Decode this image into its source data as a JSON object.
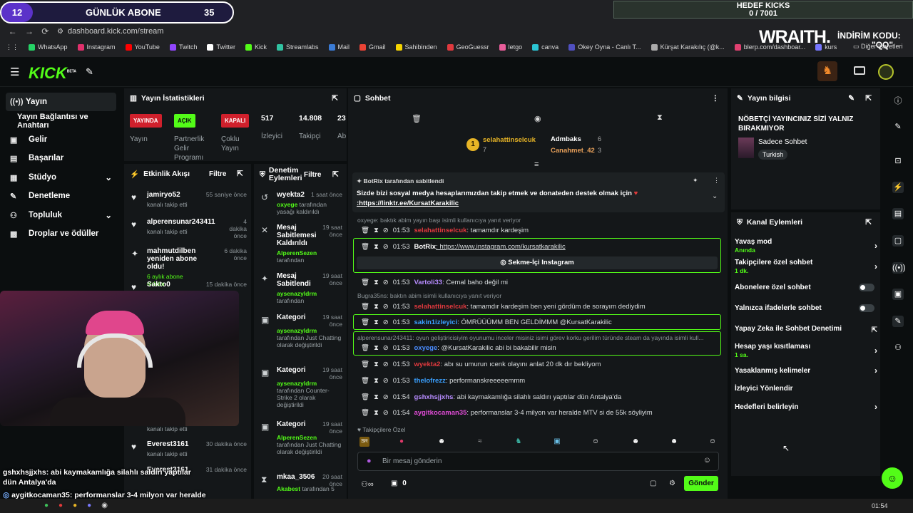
{
  "overlay": {
    "sub_count": "12",
    "sub_label": "GÜNLÜK ABONE",
    "sub_goal": "35",
    "kicks_title": "HEDEF KICKS",
    "kicks_value": "0 / 7001",
    "sponsor": "WRAITH.",
    "promo_line1": "İNDİRİM KODU:",
    "promo_line2": "\"QQ\"",
    "cam_chat": [
      {
        "user": "gshxhsjjxhs",
        "text": ": abi kaymakamlığa silahlı saldırı yaptılar dün Antalya'da"
      },
      {
        "user": "aygitkocaman35",
        "text": ": performanslar 3-4 milyon var heralde MTV si de 55k söyliyim"
      }
    ]
  },
  "browser": {
    "url": "dashboard.kick.com/stream",
    "bookmarks": [
      "WhatsApp",
      "Instagram",
      "YouTube",
      "Twitch",
      "Twitter",
      "Kick",
      "Streamlabs",
      "Mail",
      "Gmail",
      "Sahibinden",
      "GeoGuessr",
      "letgo",
      "canva",
      "Okey Oyna - Canlı T...",
      "Kürşat Karakılıç (@k...",
      "blerp.com/dashboar...",
      "kurs"
    ],
    "bookmarks_folder": "Diğer İşaretleri",
    "clock": "01:54"
  },
  "brand": {
    "logo": "KICK",
    "beta": "BETA"
  },
  "sidebar": {
    "items": [
      {
        "label": "Yayın",
        "icon": "broadcast-icon"
      },
      {
        "label": "Yayın Bağlantısı ve Anahtarı"
      },
      {
        "label": "Gelir",
        "icon": "money-icon"
      },
      {
        "label": "Başarılar",
        "icon": "trophy-icon"
      },
      {
        "label": "Stüdyo",
        "icon": "studio-icon"
      },
      {
        "label": "Denetleme",
        "icon": "wrench-icon"
      },
      {
        "label": "Topluluk",
        "icon": "community-icon"
      },
      {
        "label": "Droplar ve ödüller",
        "icon": "gift-icon"
      }
    ]
  },
  "stats": {
    "title": "Yayın İstatistikleri",
    "items": [
      {
        "badge": "YAYINDA",
        "label": "Yayın",
        "color": "#d0202c"
      },
      {
        "badge": "AÇIK",
        "label": "Partnerlik Gelir Programı",
        "color": "#53fc18"
      },
      {
        "badge": "KAPALI",
        "label": "Çoklu Yayın",
        "color": "#d0202c"
      },
      {
        "value": "517",
        "label": "İzleyici"
      },
      {
        "value": "14.808",
        "label": "Takipçi"
      },
      {
        "value": "23",
        "label": "Ab"
      }
    ]
  },
  "activity": {
    "title": "Etkinlik Akışı",
    "filter": "Filtre",
    "events": [
      {
        "name": "jamiryo52",
        "time": "55 saniye önce",
        "sub": "kanalı takip etti"
      },
      {
        "name": "alperensunar243411",
        "time": "4 dakika önce",
        "sub": "kanalı takip etti"
      },
      {
        "name": "mahmutdilben yeniden abone oldu!",
        "time": "6 dakika önce",
        "sub": "6 aylık abone oldular"
      },
      {
        "name": "Sakto0",
        "time": "15 dakika önce",
        "sub": ""
      },
      {
        "name": "",
        "time": "",
        "sub": "kanalı takip etti"
      },
      {
        "name": "Everest3161",
        "time": "30 dakika önce",
        "sub": "kanalı takip etti"
      },
      {
        "name": "Everest3161",
        "time": "31 dakika önce",
        "sub": ""
      }
    ]
  },
  "mod_actions": {
    "title": "Denetim Eylemleri",
    "filter": "Filtre",
    "items": [
      {
        "name": "wyekta2",
        "time": "1 saat önce",
        "det_g": "oxyege",
        "det": " tarafından yasağı kaldırıldı"
      },
      {
        "name": "Mesaj Sabitlemesi Kaldırıldı",
        "time": "19 saat önce",
        "det_g": "AlperenSezen",
        "det": " tarafından"
      },
      {
        "name": "Mesaj Sabitlendi",
        "time": "19 saat önce",
        "det_g": "aysenazyldrm",
        "det": " tarafından"
      },
      {
        "name": "Kategori",
        "time": "19 saat önce",
        "det_g": "aysenazyldrm",
        "det": " tarafından Just Chatting olarak değiştirildi"
      },
      {
        "name": "Kategori",
        "time": "19 saat önce",
        "det_g": "aysenazyldrm",
        "det": " tarafından Counter-Strike 2 olarak değiştirildi"
      },
      {
        "name": "Kategori",
        "time": "19 saat önce",
        "det_g": "AlperenSezen",
        "det": " tarafından Just Chatting olarak değiştirildi"
      },
      {
        "name": "mkaa_3506",
        "time": "20 saat önce",
        "det_g": "Akabest",
        "det": " tarafından 5"
      }
    ]
  },
  "chat": {
    "title": "Sohbet",
    "leaderboard": [
      {
        "name": "selahattinselcuk",
        "value": "7"
      },
      {
        "name": "Admbaks",
        "value": "6"
      },
      {
        "name": "Canahmet_42",
        "value": "3"
      }
    ],
    "pinned_by": "BotRix tarafından sabitlendi",
    "pinned_text": "Sizde bizi sosyal medya hesaplarımızdan takip etmek ve donateden destek olmak için",
    "pinned_link": ":https://linktr.ee/KursatKarakilic",
    "messages": [
      {
        "reply": "oxyege: baktık abim yayın başı isimli kullanıcıya yanıt veriyor"
      },
      {
        "time": "01:53",
        "user": "selahattinselcuk",
        "color": "#e0393e",
        "text": ": tamamdır kardeşim"
      },
      {
        "time": "01:53",
        "user": "BotRix",
        "color": "#ffffff",
        "text": ": https://www.instagram.com/kursatkarakilic"
      },
      {
        "button": "Sekme-İçi Instagram"
      },
      {
        "time": "01:53",
        "user": "Vartoli33",
        "color": "#b78cff",
        "text": ": Cemal baho değil mi"
      },
      {
        "reply": "Bugra35ns: baktın abim isimli kullanıcıya yanıt veriyor"
      },
      {
        "time": "01:53",
        "user": "selahattinselcuk",
        "color": "#e0393e",
        "text": ": tamamdır kardeşim ben yeni gördüm de sorayım dediydim"
      },
      {
        "time": "01:53",
        "user": "sakin1izleyici",
        "color": "#3aa0ff",
        "text": ": ÖMRÜÜÜMM BEN GELDİMMM @KursatKarakilic"
      },
      {
        "reply": "alperensunar243411: oyun geliştiricisiyim oyunumu inceler misiniz isimi görev korku gerilim türünde steam da yayında isimli kull..."
      },
      {
        "time": "01:53",
        "user": "oxyege",
        "color": "#4a8cff",
        "text": ": @KursatKarakilic abi bi bakabilir misin"
      },
      {
        "time": "01:53",
        "user": "wyekta2",
        "color": "#e0393e",
        "text": ": abı su umurun ıcenk olayını anlat 20 dk dır bekliyom"
      },
      {
        "time": "01:53",
        "user": "thelofrezz",
        "color": "#3aa0ff",
        "text": ": performanskreeeeemmm"
      },
      {
        "time": "01:54",
        "user": "gshxhsjjxhs",
        "color": "#b78cff",
        "text": ": abi kaymakamlığa silahlı saldırı yaptılar dün Antalya'da"
      },
      {
        "time": "01:54",
        "user": "aygitkocaman35",
        "color": "#e04bd6",
        "text": ": performanslar 3-4 milyon var heralde MTV si de 55k söyliyim"
      }
    ],
    "followers_only": "Takipçilere Özel",
    "input_placeholder": "Bir mesaj gönderin",
    "points": "0",
    "send": "Gönder"
  },
  "stream_info": {
    "title": "Yayın bilgisi",
    "stream_title": "NÖBETÇİ YAYINCINIZ SİZİ YALNIZ BIRAKMIYOR",
    "category": "Sadece Sohbet",
    "language": "Turkish"
  },
  "channel_actions": {
    "title": "Kanal Eylemleri",
    "rows": [
      {
        "label": "Yavaş mod",
        "sub": "Anında",
        "kind": "arrow"
      },
      {
        "label": "Takipçilere özel sohbet",
        "sub": "1 dk.",
        "kind": "arrow"
      },
      {
        "label": "Abonelere özel sohbet",
        "kind": "toggle"
      },
      {
        "label": "Yalnızca ifadelerle sohbet",
        "kind": "toggle"
      },
      {
        "label": "Yapay Zeka ile Sohbet Denetimi",
        "kind": "ext"
      },
      {
        "label": "Hesap yaşı kısıtlaması",
        "sub": "1 sa.",
        "kind": "arrow"
      },
      {
        "label": "Yasaklanmış kelimeler",
        "kind": "arrow"
      },
      {
        "label": "İzleyici Yönlendir",
        "kind": "none"
      },
      {
        "label": "Hedefleri belirleyin",
        "kind": "arrow"
      }
    ]
  },
  "colors": {
    "accent": "#53fc18",
    "bg": "#0b0e0f",
    "panel": "#141719",
    "live_red": "#d0202c"
  }
}
